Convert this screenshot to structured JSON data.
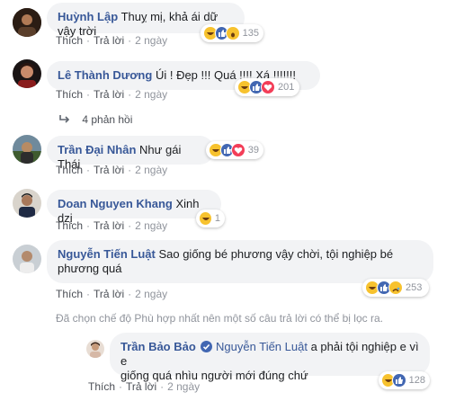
{
  "actions": {
    "like": "Thích",
    "reply": "Trả lời",
    "sep": "·"
  },
  "comments": [
    {
      "name": "Huỳnh Lập",
      "text": "Thuỵ mị, khả ái dữ vậy trời",
      "reactions": [
        "haha",
        "like",
        "wow"
      ],
      "count": "135",
      "time": "2 ngày"
    },
    {
      "name": "Lê Thành Dương",
      "text": "Úi ! Đẹp !!! Quá !!!! Xá !!!!!!!",
      "reactions": [
        "haha",
        "like",
        "love"
      ],
      "count": "201",
      "time": "2 ngày",
      "replies": "4 phản hồi"
    },
    {
      "name": "Trần Đại Nhân",
      "text": "Như gái Thái",
      "reactions": [
        "haha",
        "like",
        "love"
      ],
      "count": "39",
      "time": "2 ngày"
    },
    {
      "name": "Doan Nguyen Khang",
      "text": "Xinh dzị",
      "reactions": [
        "haha"
      ],
      "count": "1",
      "time": "2 ngày"
    },
    {
      "name": "Nguyễn Tiến Luật",
      "text_line1": "Sao giống bé phương vậy chời, tội nghiệp bé",
      "text_line2": "phương quá",
      "reactions": [
        "haha",
        "like",
        "sad"
      ],
      "count": "253",
      "time": "2 ngày"
    }
  ],
  "filter_notice": "Đã chọn chế độ Phù hợp nhất nên một số câu trả lời có thể bị lọc ra.",
  "reply": {
    "name": "Trần Bảo Bảo",
    "mention": "Nguyễn Tiến Luật",
    "text_line1": "a phải tội nghiệp e vì e",
    "text_line2": "giống quá nhìu người mới đúng chứ",
    "reactions": [
      "haha",
      "like"
    ],
    "count": "128",
    "time": "2 ngày"
  },
  "colors": {
    "name": "#385898",
    "bubble": "#f2f3f5",
    "meta": "#90949c",
    "verified": "#4267b2"
  }
}
